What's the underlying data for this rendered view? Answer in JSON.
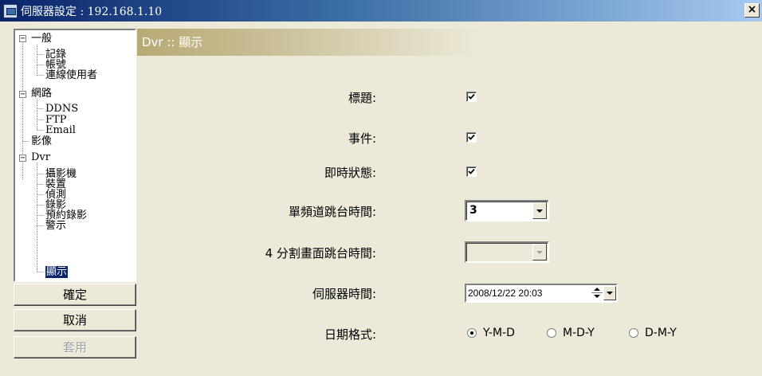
{
  "window": {
    "title": "伺服器設定 : 192.168.1.10",
    "close_label": "×"
  },
  "tree": {
    "items": [
      {
        "label": "一般",
        "expander": "−"
      },
      {
        "label": "記錄"
      },
      {
        "label": "帳號"
      },
      {
        "label": "連線使用者"
      },
      {
        "label": "網路",
        "expander": "−"
      },
      {
        "label": "DDNS"
      },
      {
        "label": "FTP"
      },
      {
        "label": "Email"
      },
      {
        "label": "影像"
      },
      {
        "label": "Dvr",
        "expander": "−"
      },
      {
        "label": "攝影機"
      },
      {
        "label": "裝置"
      },
      {
        "label": "偵測"
      },
      {
        "label": "錄影"
      },
      {
        "label": "預約錄影"
      },
      {
        "label": "警示"
      },
      {
        "label": "顯示",
        "selected": true
      }
    ]
  },
  "buttons": {
    "ok": "確定",
    "cancel": "取消",
    "apply": "套用"
  },
  "panel": {
    "header": "Dvr :: 顯示",
    "fields": {
      "title_label": "標題:",
      "title_checked": true,
      "event_label": "事件:",
      "event_checked": true,
      "realtime_label": "即時狀態:",
      "realtime_checked": true,
      "single_channel_label": "單頻道跳台時間:",
      "single_channel_value": "3",
      "quad_label": "4 分割畫面跳台時間:",
      "quad_value": "",
      "server_time_label": "伺服器時間:",
      "server_time_value": "2008/12/22 20:03",
      "date_format_label": "日期格式:",
      "date_format_options": [
        "Y-M-D",
        "M-D-Y",
        "D-M-Y"
      ],
      "date_format_selected": "Y-M-D"
    }
  }
}
